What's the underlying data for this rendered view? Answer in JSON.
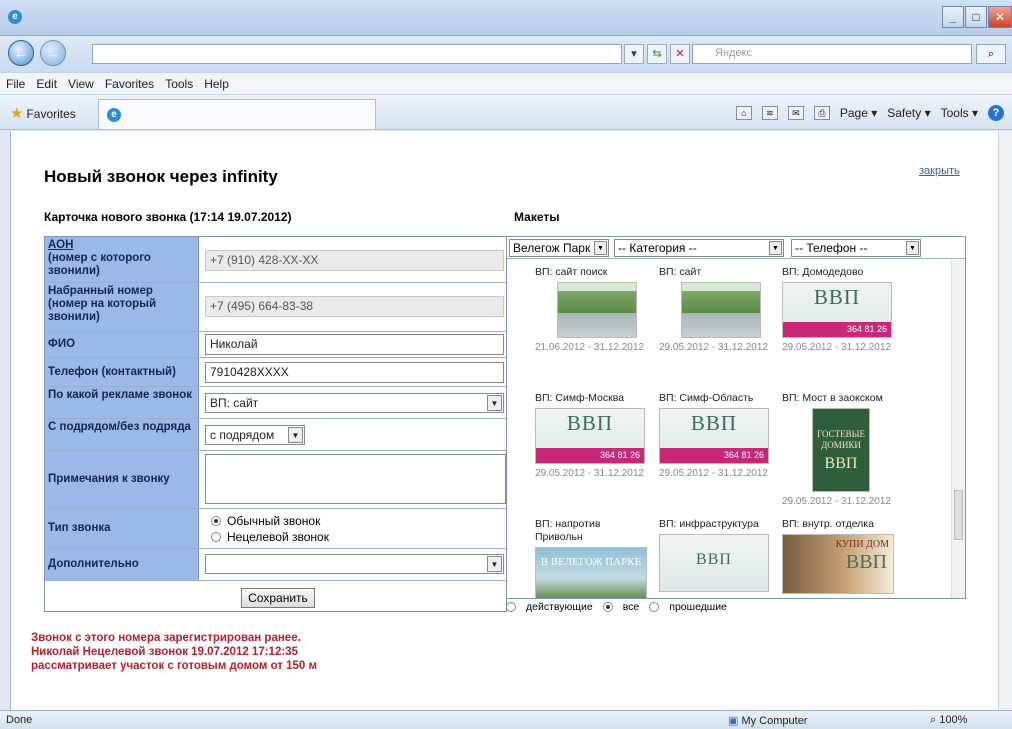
{
  "browser": {
    "address_url": "",
    "search_placeholder": "Яндекс",
    "menu": [
      "File",
      "Edit",
      "View",
      "Favorites",
      "Tools",
      "Help"
    ],
    "favorites_label": "Favorites",
    "commands": [
      "Page ▾",
      "Safety ▾",
      "Tools ▾"
    ],
    "status_done": "Done",
    "status_zone": "My Computer",
    "status_zoom": "100%"
  },
  "page": {
    "title": "Новый звонок через infinity",
    "close_link": "закрыть",
    "card_heading": "Карточка нового звонка (17:14 19.07.2012)",
    "mockups_heading": "Макеты"
  },
  "form": {
    "aon_label": "АОН",
    "aon_label_rest": "(номер с которого звонили)",
    "aon_value": "+7 (910) 428-XX-XX",
    "dialed_label": "Набранный номер (номер на который звонили)",
    "dialed_value": "+7 (495) 664-83-38",
    "fio_label": "ФИО",
    "fio_value": "Николай",
    "phone_label": "Телефон (контактный)",
    "phone_value": "7910428XXXX",
    "ad_label": "По какой рекламе звонок",
    "ad_value": "ВП: сайт",
    "contractor_label": "С подрядом/без подряда",
    "contractor_value": "с подрядом",
    "notes_label": "Примечания к звонку",
    "notes_value": "",
    "type_label": "Тип звонка",
    "type_options": [
      "Обычный звонок",
      "Нецелевой звонок"
    ],
    "extra_label": "Дополнительно",
    "extra_value": "",
    "save_label": "Сохранить"
  },
  "warning": [
    "Звонок с этого номера зарегистрирован ранее.",
    "Николай Нецелевой звонок 19.07.2012 17:12:35",
    "рассматривает участок с готовым домом от 150 м"
  ],
  "filters": {
    "project": "Велегож Парк",
    "category": "-- Категория --",
    "phone": "-- Телефон --"
  },
  "mockups": [
    {
      "name": "ВП: сайт поиск",
      "date": "21.06.2012 - 31.12.2012"
    },
    {
      "name": "ВП: сайт",
      "date": "29.05.2012 - 31.12.2012"
    },
    {
      "name": "ВП: Домодедово",
      "date": "29.05.2012 - 31.12.2012"
    },
    {
      "name": "ВП: Симф-Москва",
      "date": "29.05.2012 - 31.12.2012"
    },
    {
      "name": "ВП: Симф-Область",
      "date": "29.05.2012 - 31.12.2012"
    },
    {
      "name": "ВП: Мост в заокском",
      "date": "29.05.2012 - 31.12.2012"
    },
    {
      "name": "ВП: напротив Привольн",
      "date": ""
    },
    {
      "name": "ВП: инфраструктура",
      "date": ""
    },
    {
      "name": "ВП: внутр. отделка",
      "date": ""
    }
  ],
  "thumb_text": {
    "vvp": "ВВП",
    "phone_bar": "364 81 26",
    "park": "В ВЕЛЕГОЖ ПАРКЕ",
    "house": "КУПИ ДОМ",
    "guest": "ГОСТЕВЫЕ ДОМИКИ"
  },
  "legend": [
    "действующие",
    "все",
    "прошедшие"
  ]
}
